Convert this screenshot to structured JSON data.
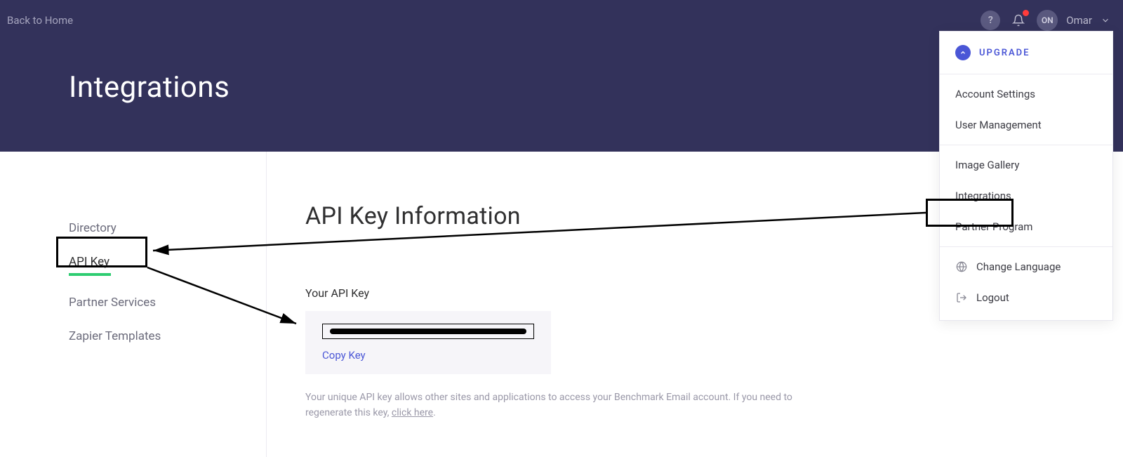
{
  "header": {
    "back_label": "Back to Home",
    "title": "Integrations",
    "user": {
      "initials": "ON",
      "name": "Omar"
    }
  },
  "sidebar": {
    "items": [
      {
        "label": "Directory",
        "active": false
      },
      {
        "label": "API Key",
        "active": true
      },
      {
        "label": "Partner Services",
        "active": false
      },
      {
        "label": "Zapier Templates",
        "active": false
      }
    ]
  },
  "main": {
    "section_title": "API Key Information",
    "field_label": "Your API Key",
    "copy_label": "Copy Key",
    "help_pre": "Your unique API key allows other sites and applications to access your Benchmark Email account. If you need to regenerate this key, ",
    "help_link": "click here",
    "help_post": "."
  },
  "menu": {
    "upgrade": "UPGRADE",
    "items_a": [
      "Account Settings",
      "User Management"
    ],
    "items_b": [
      "Image Gallery",
      "Integrations",
      "Partner Program"
    ],
    "lang": "Change Language",
    "logout": "Logout"
  }
}
